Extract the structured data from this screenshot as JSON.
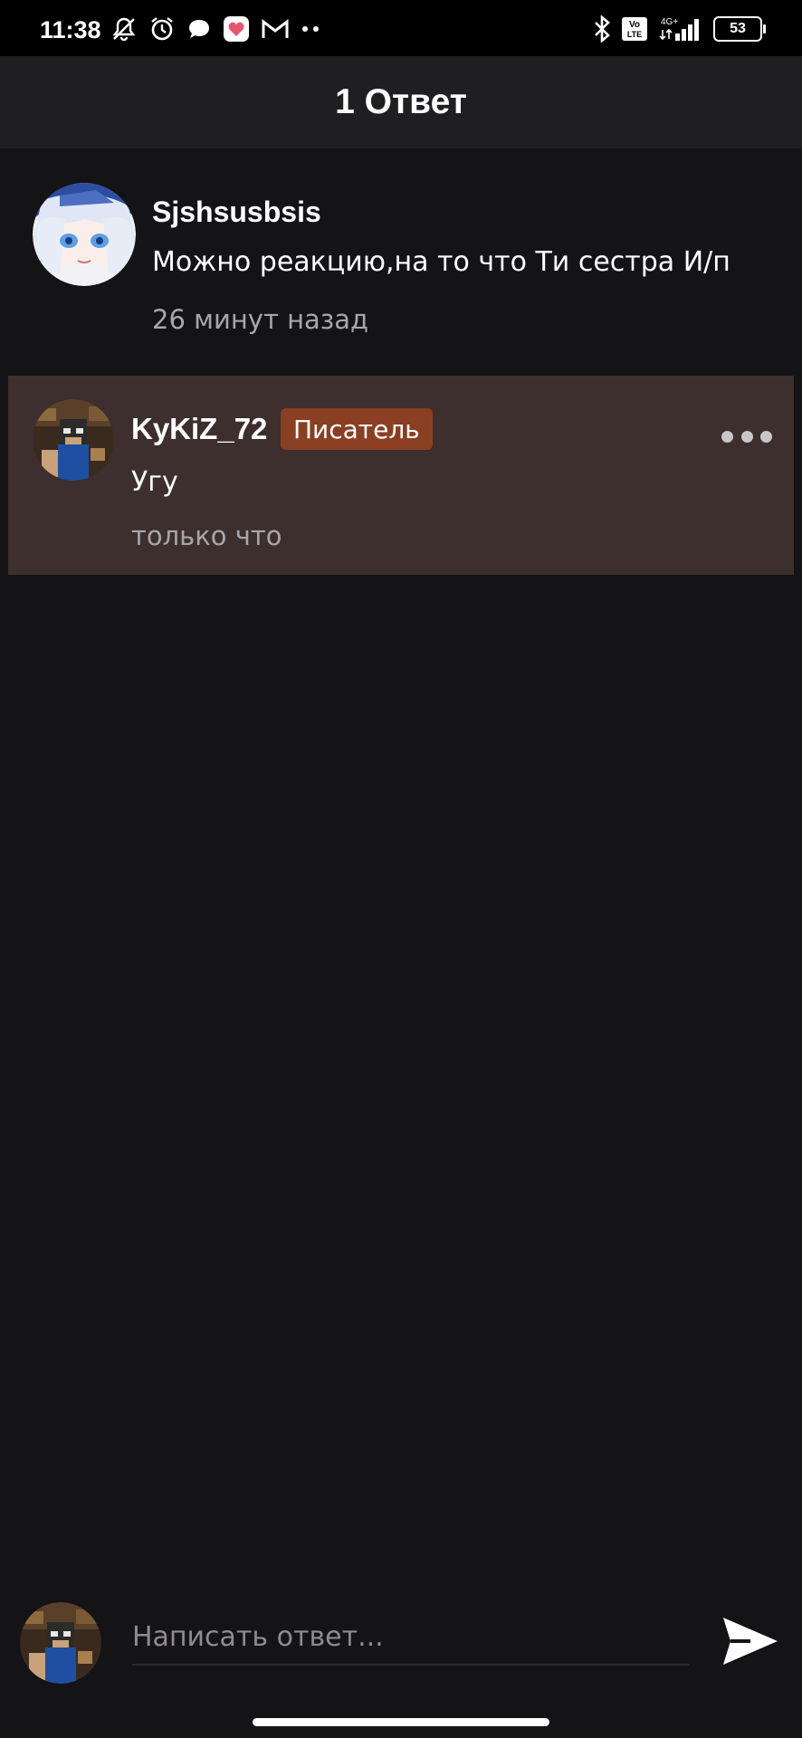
{
  "status_bar": {
    "time": "11:38",
    "battery": "53",
    "network": "4G+",
    "volte": "Vo LTE",
    "icons_left": [
      "muted-notifications-icon",
      "alarm-icon",
      "chat-bubble-icon",
      "app-heart-icon",
      "gmail-icon",
      "more-dots-icon"
    ],
    "icons_right": [
      "bluetooth-icon",
      "volte-icon",
      "signal-icon",
      "battery-icon"
    ]
  },
  "header": {
    "title": "1 Ответ"
  },
  "parent_comment": {
    "username": "Sjshsusbsis",
    "text": "Можно реакцию,на то что Ти сестра И/п",
    "timestamp": "26 минут назад"
  },
  "reply_comment": {
    "username": "KyKiZ_72",
    "badge": "Писатель",
    "text": "Угу",
    "timestamp": "только что"
  },
  "reply_bar": {
    "placeholder": "Написать ответ..."
  },
  "colors": {
    "background": "#141316",
    "header": "#1f1e21",
    "reply_highlight": "#3c2f2d",
    "badge": "#8a3f22"
  }
}
